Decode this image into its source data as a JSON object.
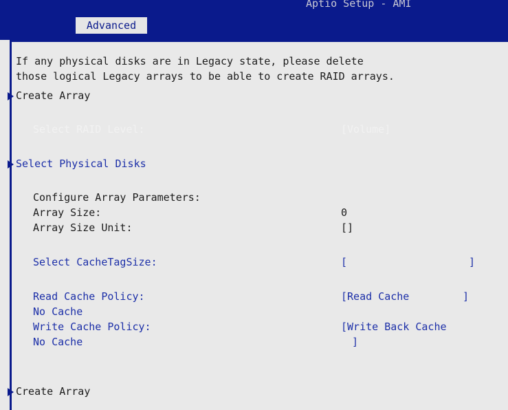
{
  "window": {
    "title": "Aptio Setup - AMI"
  },
  "tabs": [
    {
      "label": "Advanced"
    }
  ],
  "content": {
    "help_line1": "If any physical disks are in Legacy state, please delete",
    "help_line2": "those logical Legacy arrays to be able to create RAID arrays.",
    "create_array_top": "Create Array",
    "raid_level_label": "Select RAID Level:",
    "raid_level_value": "[Volume]",
    "select_disks": "Select Physical Disks",
    "configure_params": "Configure Array Parameters:",
    "array_size_label": "Array Size:",
    "array_size_value": "0",
    "array_size_unit_label": "Array Size Unit:",
    "array_size_unit_value": "[]",
    "cache_tag_label": "Select CacheTagSize:",
    "cache_tag_value_open": "[",
    "cache_tag_value_close": "]",
    "read_cache_label": "Read Cache Policy:",
    "read_cache_label_2": "No Cache",
    "read_cache_value_open": "[Read Cache",
    "read_cache_value_close": "]",
    "write_cache_label": "Write Cache Policy:",
    "write_cache_label_2": "No Cache",
    "write_cache_value": "[Write Back Cache",
    "write_cache_value_close": "]",
    "create_array_bottom": "Create Array"
  },
  "colors": {
    "header_blue": "#0a1a8c",
    "text_blue": "#1c2fa8",
    "background": "#e9e9e9",
    "text_white": "#f2f2f2"
  }
}
